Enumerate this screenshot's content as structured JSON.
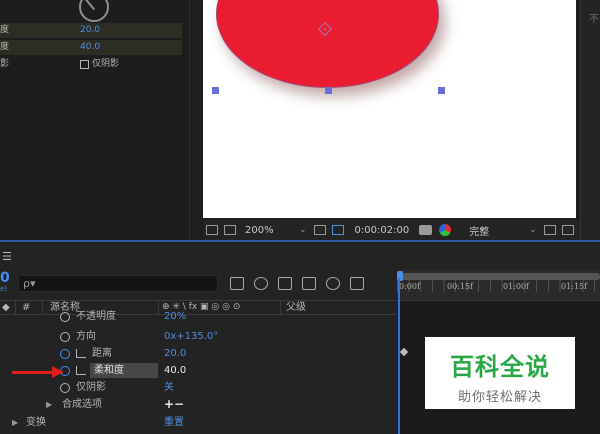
{
  "effect_panel": {
    "rows": [
      {
        "label": "度",
        "value": "20.0"
      },
      {
        "label": "度",
        "value": "40.0"
      },
      {
        "label": "影",
        "checkbox_label": "仅阴影"
      }
    ]
  },
  "viewer": {
    "zoom": "200%",
    "timecode": "0:00:02:00",
    "quality": "完整",
    "right_panel_text": "不"
  },
  "timeline": {
    "menu_icon": "☰",
    "current_time": "0",
    "current_time_sub": "e)",
    "search_placeholder": "ρ▾",
    "ruler_labels": [
      "0:00f",
      "00:15f",
      "01:00f",
      "01:15f"
    ],
    "columns": {
      "num": "#",
      "source_name": "源名称",
      "switches": "⊕ ✳ \\ fx ▣ ◎ ◎ ⊙",
      "parent": "父级"
    },
    "rows": [
      {
        "name": "不透明度",
        "value": "20%"
      },
      {
        "name": "方向",
        "value": "0x+135.0°"
      },
      {
        "name": "距离",
        "value": "20.0"
      },
      {
        "name": "柔和度",
        "value": "40.0"
      },
      {
        "name": "仅阴影",
        "value": "关"
      },
      {
        "name": "合成选项",
        "value": "+−"
      },
      {
        "name": "变换",
        "value": "重置"
      }
    ]
  },
  "watermark": {
    "title": "百科全说",
    "subtitle": "助你轻松解决"
  },
  "colors": {
    "accent_blue": "#3f8ff0",
    "circle_red": "#ea1c31",
    "arrow_red": "#e01e1e",
    "watermark_green": "#2aa845"
  }
}
